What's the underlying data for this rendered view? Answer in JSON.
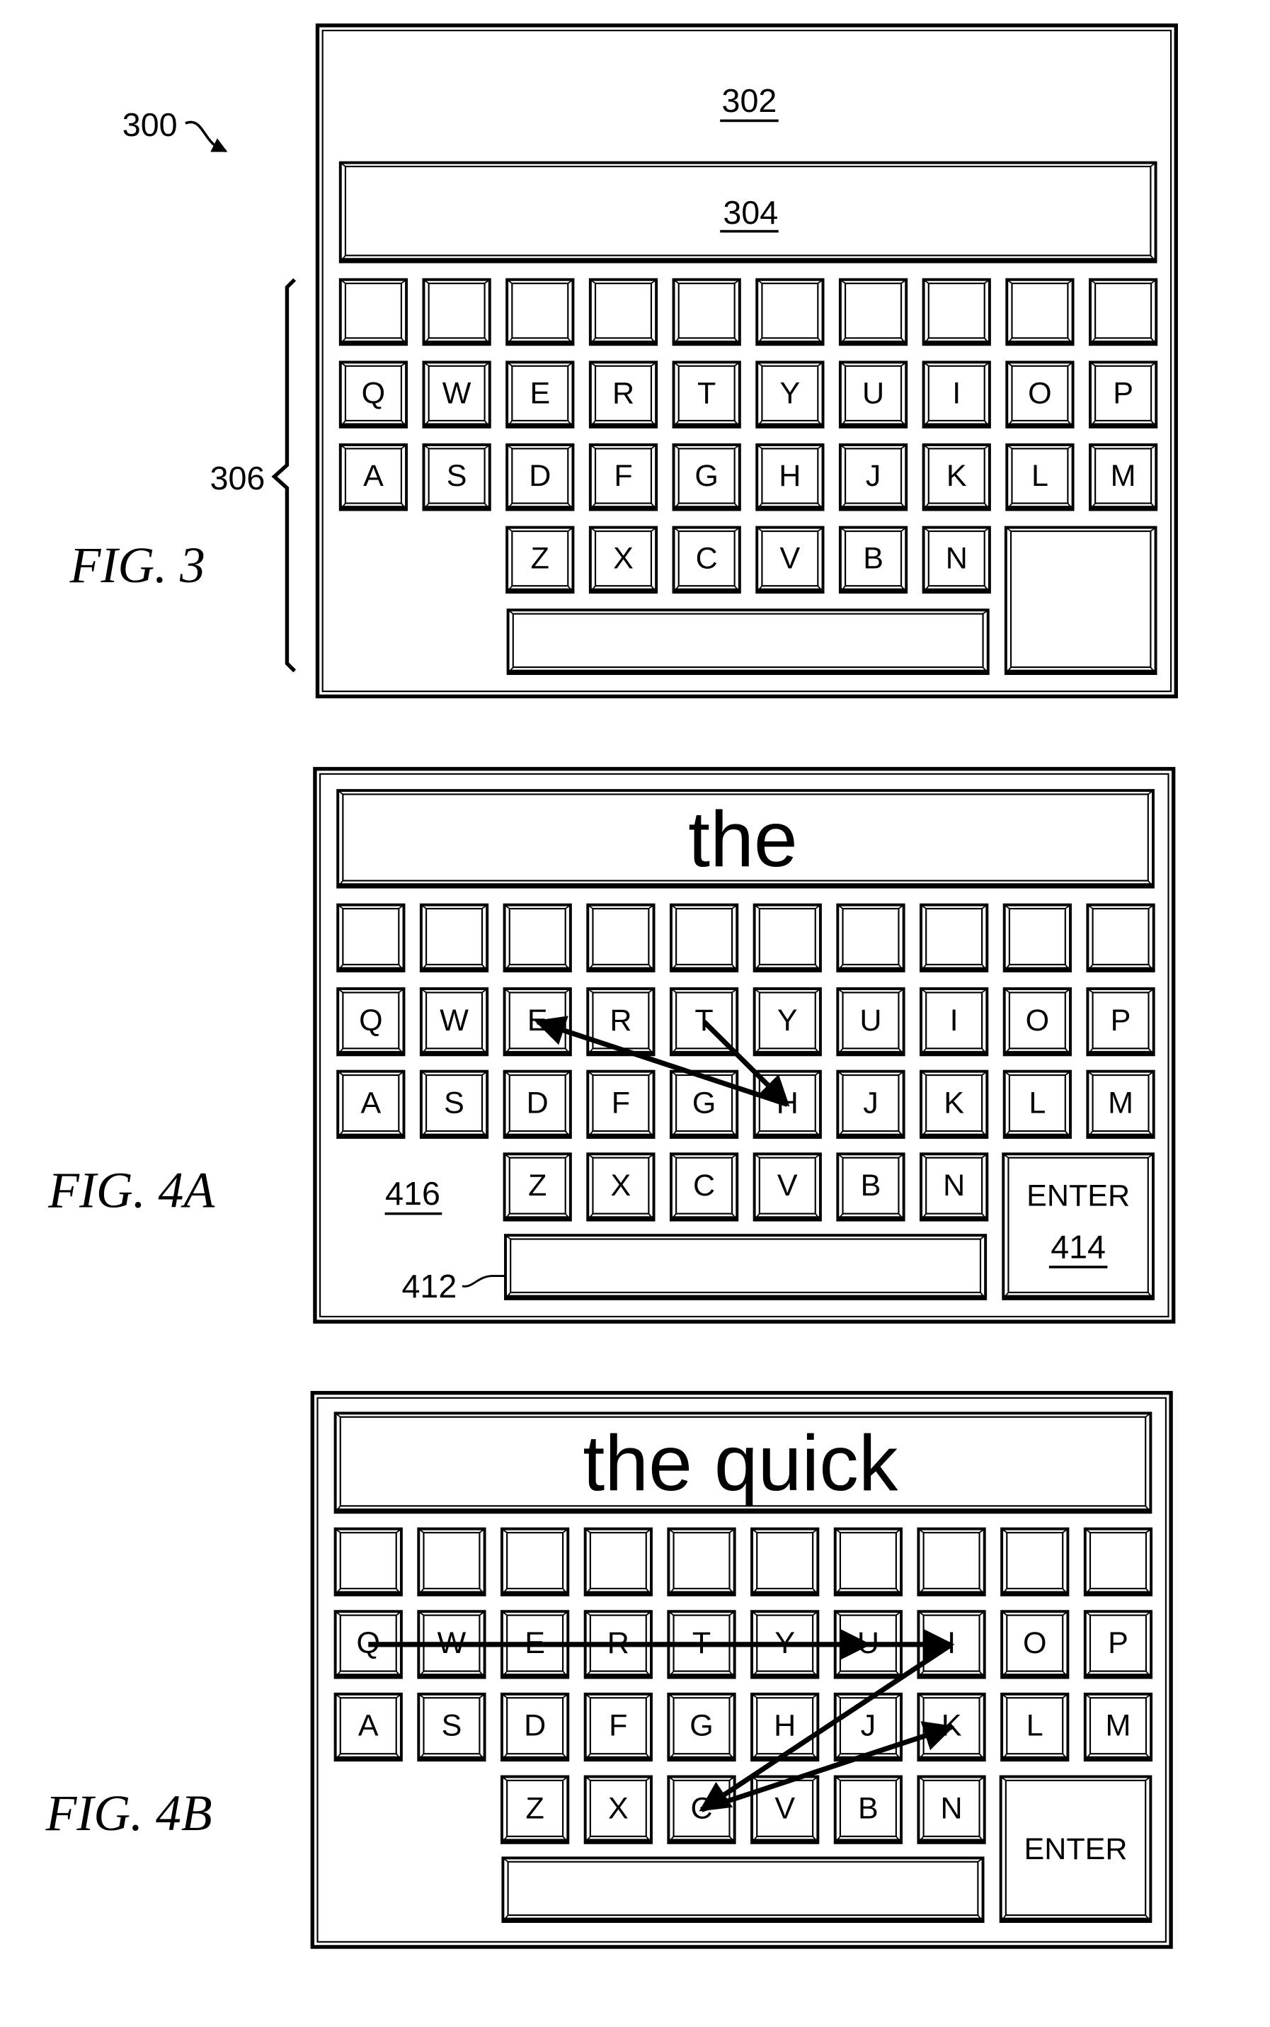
{
  "page": {
    "background": "#ffffff",
    "ink": "#000000"
  },
  "figures": [
    {
      "id": "fig3",
      "caption": "FIG. 3",
      "ref_device": "300",
      "ref_top_area": "302",
      "ref_text_field": "304",
      "ref_keyboard": "306",
      "display_text": "304",
      "rows": [
        [
          "",
          "",
          "",
          "",
          "",
          "",
          "",
          "",
          "",
          ""
        ],
        [
          "Q",
          "W",
          "E",
          "R",
          "T",
          "Y",
          "U",
          "I",
          "O",
          "P"
        ],
        [
          "A",
          "S",
          "D",
          "F",
          "G",
          "H",
          "J",
          "K",
          "L",
          "M"
        ],
        [
          "Z",
          "X",
          "C",
          "V",
          "B",
          "N"
        ]
      ],
      "enter_label": "",
      "path": []
    },
    {
      "id": "fig4a",
      "caption": "FIG. 4A",
      "display_text": "the",
      "ref_area": "416",
      "ref_spacebar": "412",
      "ref_enter": "414",
      "rows": [
        [
          "",
          "",
          "",
          "",
          "",
          "",
          "",
          "",
          "",
          ""
        ],
        [
          "Q",
          "W",
          "E",
          "R",
          "T",
          "Y",
          "U",
          "I",
          "O",
          "P"
        ],
        [
          "A",
          "S",
          "D",
          "F",
          "G",
          "H",
          "J",
          "K",
          "L",
          "M"
        ],
        [
          "Z",
          "X",
          "C",
          "V",
          "B",
          "N"
        ]
      ],
      "enter_label": "ENTER",
      "path": [
        "T",
        "H",
        "E"
      ]
    },
    {
      "id": "fig4b",
      "caption": "FIG. 4B",
      "display_text": "the quick",
      "rows": [
        [
          "",
          "",
          "",
          "",
          "",
          "",
          "",
          "",
          "",
          ""
        ],
        [
          "Q",
          "W",
          "E",
          "R",
          "T",
          "Y",
          "U",
          "I",
          "O",
          "P"
        ],
        [
          "A",
          "S",
          "D",
          "F",
          "G",
          "H",
          "J",
          "K",
          "L",
          "M"
        ],
        [
          "Z",
          "X",
          "C",
          "V",
          "B",
          "N"
        ]
      ],
      "enter_label": "ENTER",
      "path": [
        "Q",
        "U",
        "I",
        "C",
        "K"
      ]
    }
  ]
}
